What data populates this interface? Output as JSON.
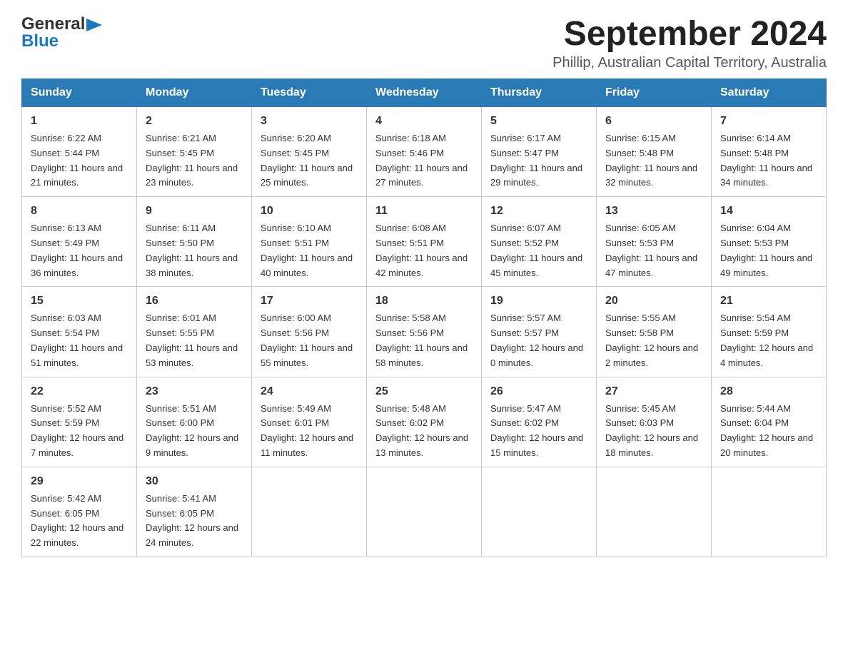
{
  "header": {
    "logo": {
      "general": "General",
      "blue": "Blue",
      "alt": "GeneralBlue logo"
    },
    "title": "September 2024",
    "subtitle": "Phillip, Australian Capital Territory, Australia"
  },
  "calendar": {
    "days_of_week": [
      "Sunday",
      "Monday",
      "Tuesday",
      "Wednesday",
      "Thursday",
      "Friday",
      "Saturday"
    ],
    "weeks": [
      [
        {
          "day": "1",
          "sunrise": "Sunrise: 6:22 AM",
          "sunset": "Sunset: 5:44 PM",
          "daylight": "Daylight: 11 hours and 21 minutes."
        },
        {
          "day": "2",
          "sunrise": "Sunrise: 6:21 AM",
          "sunset": "Sunset: 5:45 PM",
          "daylight": "Daylight: 11 hours and 23 minutes."
        },
        {
          "day": "3",
          "sunrise": "Sunrise: 6:20 AM",
          "sunset": "Sunset: 5:45 PM",
          "daylight": "Daylight: 11 hours and 25 minutes."
        },
        {
          "day": "4",
          "sunrise": "Sunrise: 6:18 AM",
          "sunset": "Sunset: 5:46 PM",
          "daylight": "Daylight: 11 hours and 27 minutes."
        },
        {
          "day": "5",
          "sunrise": "Sunrise: 6:17 AM",
          "sunset": "Sunset: 5:47 PM",
          "daylight": "Daylight: 11 hours and 29 minutes."
        },
        {
          "day": "6",
          "sunrise": "Sunrise: 6:15 AM",
          "sunset": "Sunset: 5:48 PM",
          "daylight": "Daylight: 11 hours and 32 minutes."
        },
        {
          "day": "7",
          "sunrise": "Sunrise: 6:14 AM",
          "sunset": "Sunset: 5:48 PM",
          "daylight": "Daylight: 11 hours and 34 minutes."
        }
      ],
      [
        {
          "day": "8",
          "sunrise": "Sunrise: 6:13 AM",
          "sunset": "Sunset: 5:49 PM",
          "daylight": "Daylight: 11 hours and 36 minutes."
        },
        {
          "day": "9",
          "sunrise": "Sunrise: 6:11 AM",
          "sunset": "Sunset: 5:50 PM",
          "daylight": "Daylight: 11 hours and 38 minutes."
        },
        {
          "day": "10",
          "sunrise": "Sunrise: 6:10 AM",
          "sunset": "Sunset: 5:51 PM",
          "daylight": "Daylight: 11 hours and 40 minutes."
        },
        {
          "day": "11",
          "sunrise": "Sunrise: 6:08 AM",
          "sunset": "Sunset: 5:51 PM",
          "daylight": "Daylight: 11 hours and 42 minutes."
        },
        {
          "day": "12",
          "sunrise": "Sunrise: 6:07 AM",
          "sunset": "Sunset: 5:52 PM",
          "daylight": "Daylight: 11 hours and 45 minutes."
        },
        {
          "day": "13",
          "sunrise": "Sunrise: 6:05 AM",
          "sunset": "Sunset: 5:53 PM",
          "daylight": "Daylight: 11 hours and 47 minutes."
        },
        {
          "day": "14",
          "sunrise": "Sunrise: 6:04 AM",
          "sunset": "Sunset: 5:53 PM",
          "daylight": "Daylight: 11 hours and 49 minutes."
        }
      ],
      [
        {
          "day": "15",
          "sunrise": "Sunrise: 6:03 AM",
          "sunset": "Sunset: 5:54 PM",
          "daylight": "Daylight: 11 hours and 51 minutes."
        },
        {
          "day": "16",
          "sunrise": "Sunrise: 6:01 AM",
          "sunset": "Sunset: 5:55 PM",
          "daylight": "Daylight: 11 hours and 53 minutes."
        },
        {
          "day": "17",
          "sunrise": "Sunrise: 6:00 AM",
          "sunset": "Sunset: 5:56 PM",
          "daylight": "Daylight: 11 hours and 55 minutes."
        },
        {
          "day": "18",
          "sunrise": "Sunrise: 5:58 AM",
          "sunset": "Sunset: 5:56 PM",
          "daylight": "Daylight: 11 hours and 58 minutes."
        },
        {
          "day": "19",
          "sunrise": "Sunrise: 5:57 AM",
          "sunset": "Sunset: 5:57 PM",
          "daylight": "Daylight: 12 hours and 0 minutes."
        },
        {
          "day": "20",
          "sunrise": "Sunrise: 5:55 AM",
          "sunset": "Sunset: 5:58 PM",
          "daylight": "Daylight: 12 hours and 2 minutes."
        },
        {
          "day": "21",
          "sunrise": "Sunrise: 5:54 AM",
          "sunset": "Sunset: 5:59 PM",
          "daylight": "Daylight: 12 hours and 4 minutes."
        }
      ],
      [
        {
          "day": "22",
          "sunrise": "Sunrise: 5:52 AM",
          "sunset": "Sunset: 5:59 PM",
          "daylight": "Daylight: 12 hours and 7 minutes."
        },
        {
          "day": "23",
          "sunrise": "Sunrise: 5:51 AM",
          "sunset": "Sunset: 6:00 PM",
          "daylight": "Daylight: 12 hours and 9 minutes."
        },
        {
          "day": "24",
          "sunrise": "Sunrise: 5:49 AM",
          "sunset": "Sunset: 6:01 PM",
          "daylight": "Daylight: 12 hours and 11 minutes."
        },
        {
          "day": "25",
          "sunrise": "Sunrise: 5:48 AM",
          "sunset": "Sunset: 6:02 PM",
          "daylight": "Daylight: 12 hours and 13 minutes."
        },
        {
          "day": "26",
          "sunrise": "Sunrise: 5:47 AM",
          "sunset": "Sunset: 6:02 PM",
          "daylight": "Daylight: 12 hours and 15 minutes."
        },
        {
          "day": "27",
          "sunrise": "Sunrise: 5:45 AM",
          "sunset": "Sunset: 6:03 PM",
          "daylight": "Daylight: 12 hours and 18 minutes."
        },
        {
          "day": "28",
          "sunrise": "Sunrise: 5:44 AM",
          "sunset": "Sunset: 6:04 PM",
          "daylight": "Daylight: 12 hours and 20 minutes."
        }
      ],
      [
        {
          "day": "29",
          "sunrise": "Sunrise: 5:42 AM",
          "sunset": "Sunset: 6:05 PM",
          "daylight": "Daylight: 12 hours and 22 minutes."
        },
        {
          "day": "30",
          "sunrise": "Sunrise: 5:41 AM",
          "sunset": "Sunset: 6:05 PM",
          "daylight": "Daylight: 12 hours and 24 minutes."
        },
        {
          "day": "",
          "sunrise": "",
          "sunset": "",
          "daylight": ""
        },
        {
          "day": "",
          "sunrise": "",
          "sunset": "",
          "daylight": ""
        },
        {
          "day": "",
          "sunrise": "",
          "sunset": "",
          "daylight": ""
        },
        {
          "day": "",
          "sunrise": "",
          "sunset": "",
          "daylight": ""
        },
        {
          "day": "",
          "sunrise": "",
          "sunset": "",
          "daylight": ""
        }
      ]
    ]
  }
}
